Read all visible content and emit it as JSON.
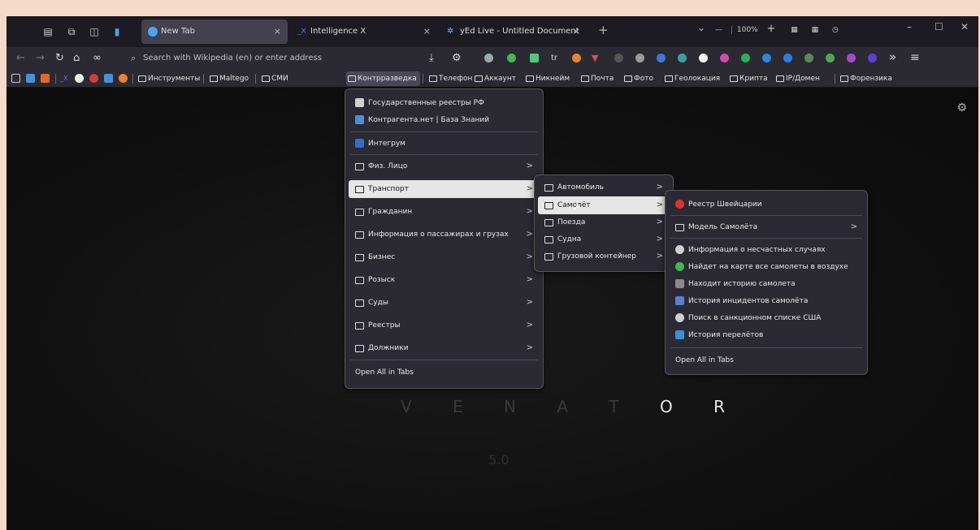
{
  "tabs": [
    {
      "label": "New Tab",
      "close": "×"
    },
    {
      "label": "Intelligence X",
      "close": "×"
    },
    {
      "label": "yEd Live - Untitled Document",
      "close": "×"
    }
  ],
  "tabbar": {
    "new_tab": "+",
    "list": "⌄",
    "minimize": "–",
    "maximize": "☐",
    "close": "✕"
  },
  "navbar": {
    "url_placeholder": "Search with Wikipedia (en) or enter address",
    "zoom": "100%",
    "zoom_minus": "—",
    "zoom_plus": "+",
    "overflow": "»",
    "menu": "≡"
  },
  "bookmarks": [
    "Инструменты",
    "Maltego",
    "СМИ",
    "Контрразведка",
    "Телефон",
    "Аккаунт",
    "Никнейм",
    "Почта",
    "Фото",
    "Геолокация",
    "Крипта",
    "IP/Домен",
    "Форензика"
  ],
  "content": {
    "brand_dim": "V E N A T",
    "brand_bright": "O R",
    "version": "5.0"
  },
  "menu1": {
    "items": [
      {
        "label": "Государственные реестры РФ",
        "type": "link",
        "color": "#d0d0d0"
      },
      {
        "label": "Контрагента.нет | База Знаний",
        "type": "link",
        "color": "#4a8fd8"
      },
      {
        "label": "Интегрум",
        "type": "link",
        "color": "#2f6fd0"
      },
      {
        "label": "Физ. Лицо",
        "type": "folder"
      },
      {
        "label": "Транспорт",
        "type": "folder"
      },
      {
        "label": "Гражданин",
        "type": "folder"
      },
      {
        "label": "Информация о пассажирах и грузах",
        "type": "folder"
      },
      {
        "label": "Бизнес",
        "type": "folder"
      },
      {
        "label": "Розыск",
        "type": "folder"
      },
      {
        "label": "Суды",
        "type": "folder"
      },
      {
        "label": "Реестры",
        "type": "folder"
      },
      {
        "label": "Должники",
        "type": "folder"
      }
    ],
    "open_all": "Open All in Tabs"
  },
  "menu2": {
    "items": [
      {
        "label": "Автомобиль"
      },
      {
        "label": "Самолёт"
      },
      {
        "label": "Поезда"
      },
      {
        "label": "Судна"
      },
      {
        "label": "Грузовой контейнер"
      }
    ]
  },
  "menu3": {
    "items": [
      {
        "label": "Реестр Швейцарии",
        "color": "#e03030"
      },
      {
        "label": "Модель Самолёта",
        "type": "folder"
      },
      {
        "label": "Информация о несчастных случаях",
        "color": "#cfcfcf"
      },
      {
        "label": "Найдет на карте все самолеты в воздухе",
        "color": "#3fb950"
      },
      {
        "label": "Находит историю самолета",
        "color": "#8a8a8a"
      },
      {
        "label": "История инцидентов самолёта",
        "color": "#5a7fd0"
      },
      {
        "label": "Поиск в санкционном списке США",
        "color": "#cfcfcf"
      },
      {
        "label": "История перелётов",
        "color": "#3b8fd8"
      }
    ],
    "open_all": "Open All in Tabs"
  },
  "arrow": ">"
}
